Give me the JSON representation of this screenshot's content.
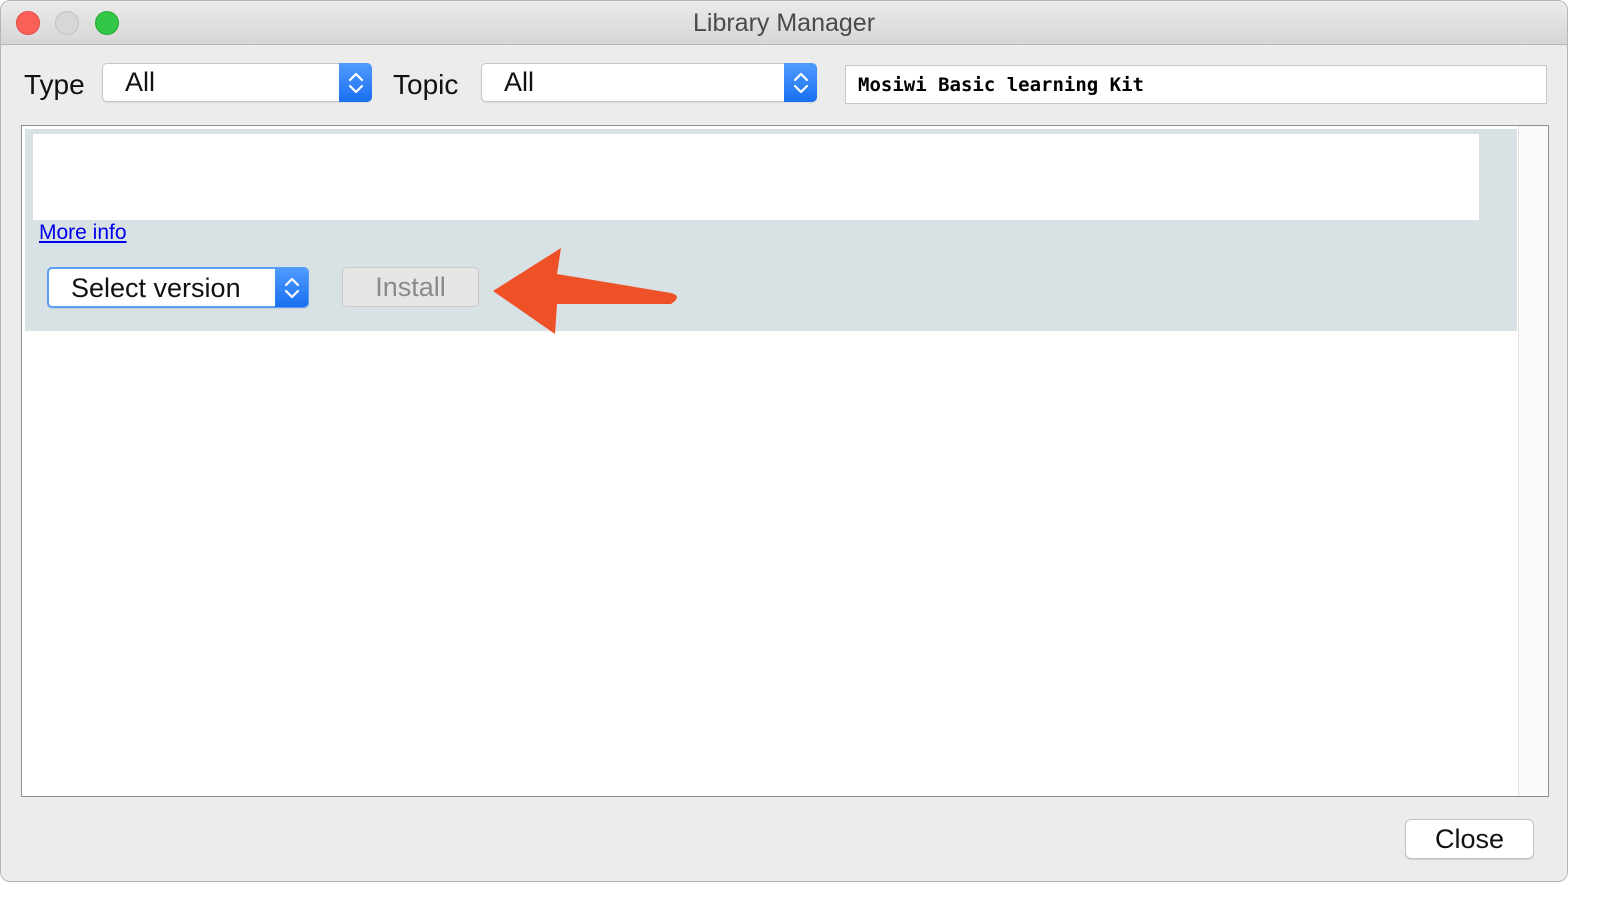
{
  "window": {
    "title": "Library Manager"
  },
  "filters": {
    "type_label": "Type",
    "type_value": "All",
    "topic_label": "Topic",
    "topic_value": "All",
    "search_value": "Mosiwi Basic learning Kit"
  },
  "library_item": {
    "more_info_label": "More info",
    "version_select_value": "Select version",
    "install_label": "Install"
  },
  "footer": {
    "close_label": "Close"
  },
  "colors": {
    "annotation_arrow": "#ee5128",
    "stepper_blue": "#1a6ff0",
    "item_background": "#d8e1e3",
    "link": "#0000ee"
  },
  "icons": {
    "stepper": "up-down-chevron-icon",
    "annotation": "red-arrow-icon"
  }
}
